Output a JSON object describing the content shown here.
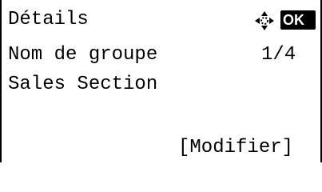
{
  "screen": {
    "title": "Détails",
    "nav_icon": "four-way-navigation-icon",
    "ok_label": "OK",
    "field_label": "Nom de groupe",
    "page_indicator": "1/4",
    "field_value": "Sales Section",
    "softkey_label": "[Modifier]"
  }
}
